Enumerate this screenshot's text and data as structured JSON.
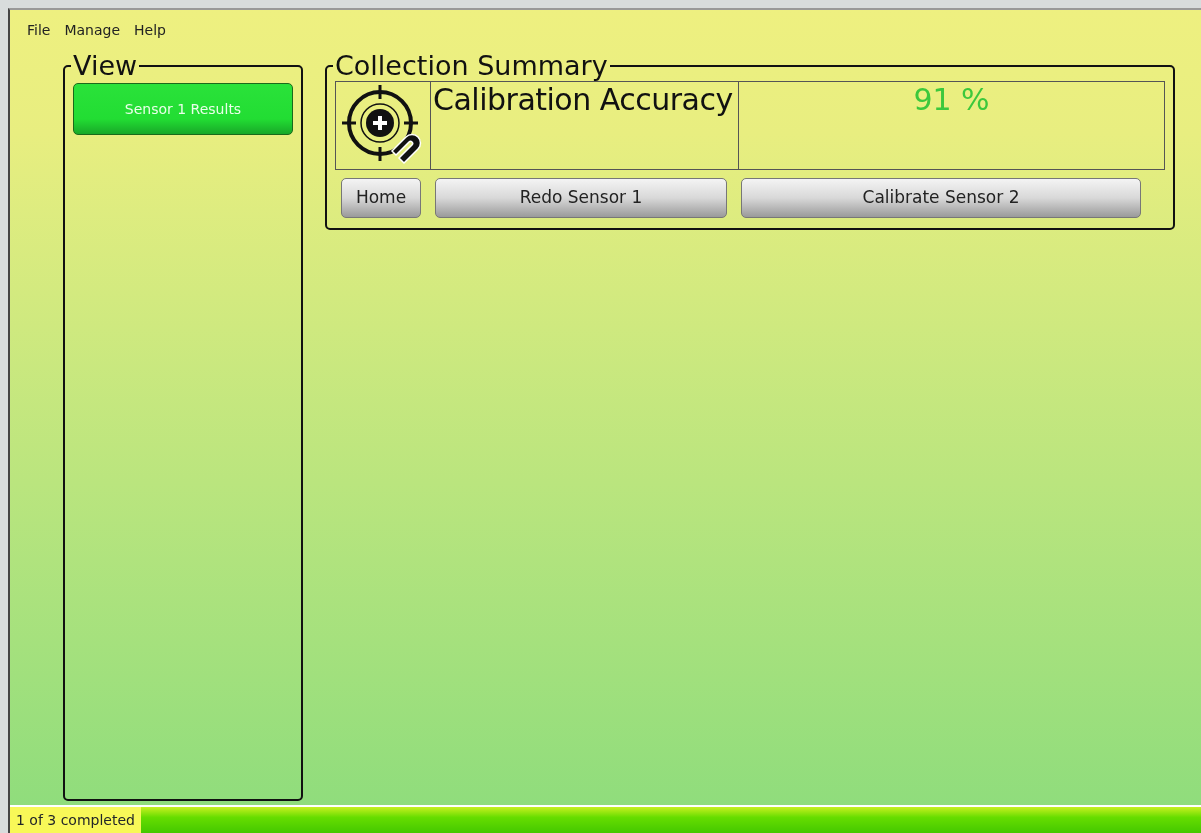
{
  "menu": [
    "File",
    "Manage",
    "Help"
  ],
  "view": {
    "title": "View",
    "items": [
      {
        "label": "Sensor 1 Results",
        "selected": true
      }
    ]
  },
  "summary": {
    "title": "Collection Summary",
    "metric": "Calibration Accuracy",
    "value": "91 %",
    "buttons": [
      "Home",
      "Redo Sensor 1",
      "Calibrate Sensor 2"
    ]
  },
  "status_bar": {
    "text": "1 of 3 completed",
    "level": 1
  }
}
